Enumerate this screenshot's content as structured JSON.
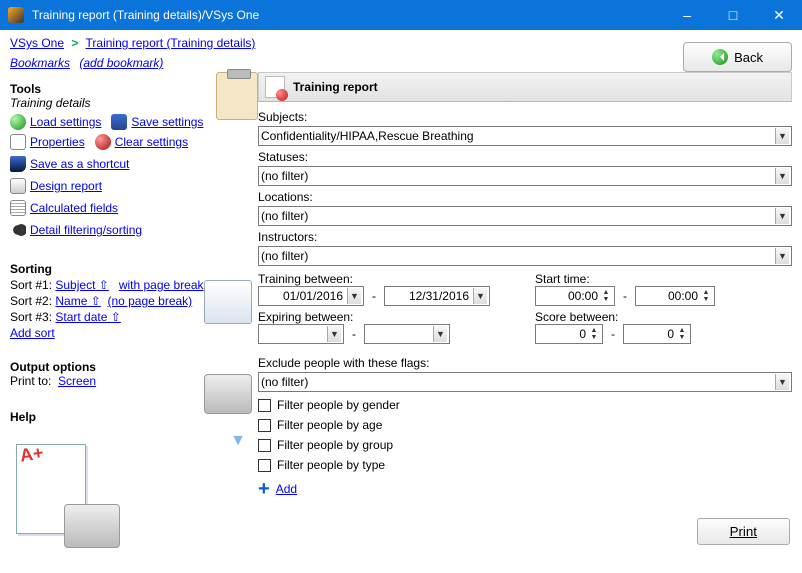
{
  "window": {
    "title": "Training report (Training details)/VSys One"
  },
  "breadcrumb": {
    "root": "VSys One",
    "current": "Training report (Training details)"
  },
  "bookmarks": {
    "label": "Bookmarks",
    "add": "(add bookmark)"
  },
  "buttons": {
    "back": "Back",
    "print": "Print"
  },
  "tools": {
    "heading": "Tools",
    "subheading": "Training details",
    "load": "Load settings",
    "save": "Save settings",
    "properties": "Properties",
    "clear": "Clear settings",
    "shortcut": "Save as a shortcut",
    "design": "Design report",
    "calculated": "Calculated fields",
    "filtering": "Detail filtering/sorting"
  },
  "sorting": {
    "heading": "Sorting",
    "s1_label": "Sort #1:",
    "s1_field": "Subject",
    "s1_opt": "with page break",
    "s2_label": "Sort #2:",
    "s2_field": "Name",
    "s2_opt": "(no page break)",
    "s3_label": "Sort #3:",
    "s3_field": "Start date",
    "add": "Add sort"
  },
  "output": {
    "heading": "Output options",
    "print_to_label": "Print to:",
    "print_to_value": "Screen"
  },
  "help": {
    "heading": "Help"
  },
  "report": {
    "title": "Training report",
    "subjects_label": "Subjects:",
    "subjects_value": "Confidentiality/HIPAA,Rescue Breathing",
    "statuses_label": "Statuses:",
    "statuses_value": "(no filter)",
    "locations_label": "Locations:",
    "locations_value": "(no filter)",
    "instructors_label": "Instructors:",
    "instructors_value": "(no filter)",
    "training_between_label": "Training between:",
    "training_from": "01/01/2016",
    "training_to": "12/31/2016",
    "start_time_label": "Start time:",
    "start_time_from": "00:00",
    "start_time_to": "00:00",
    "expiring_label": "Expiring between:",
    "score_label": "Score between:",
    "score_from": "0",
    "score_to": "0",
    "exclude_label": "Exclude people with these flags:",
    "exclude_value": "(no filter)",
    "flt_gender": "Filter people by gender",
    "flt_age": "Filter people by age",
    "flt_group": "Filter people by group",
    "flt_type": "Filter people by type",
    "add": "Add"
  }
}
